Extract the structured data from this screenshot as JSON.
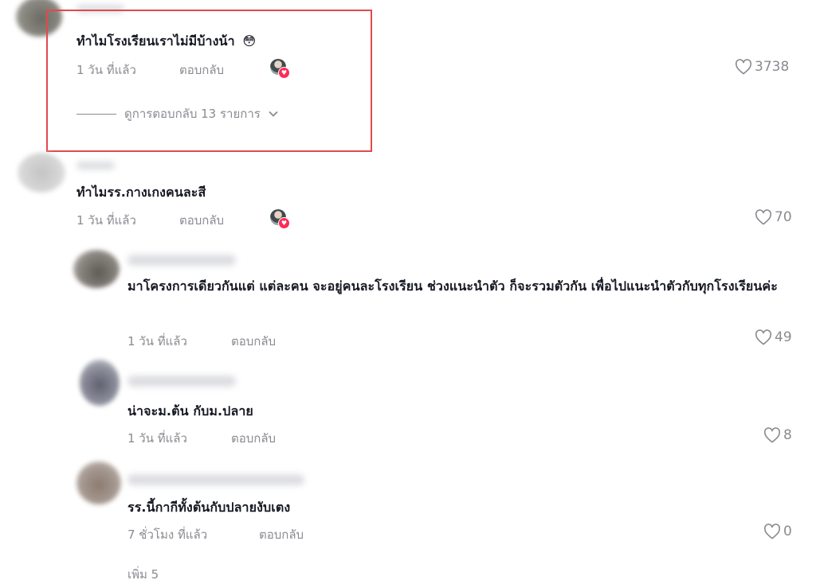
{
  "comments": [
    {
      "text": "ทำไมโรงเรียนเราไม่มีบ้างน้า",
      "emoji": "😳",
      "time": "1 วัน ที่แล้ว",
      "reply_label": "ตอบกลับ",
      "likes": "3738",
      "view_replies": "ดูการตอบกลับ 13 รายการ",
      "creator_liked": true
    },
    {
      "text": "ทำไมรร.กางเกงคนละสี",
      "time": "1 วัน ที่แล้ว",
      "reply_label": "ตอบกลับ",
      "likes": "70",
      "creator_liked": true
    },
    {
      "text": "มาโครงการเดียวกันแต่ แต่ละคน จะอยู่คนละโรงเรียน ช่วงแนะนำตัว ก็จะรวมตัวกัน เพื่อไปแนะนำตัวกับทุกโรงเรียนค่ะ",
      "time": "1 วัน ที่แล้ว",
      "reply_label": "ตอบกลับ",
      "likes": "49"
    },
    {
      "text": "น่าจะม.ต้น กับม.ปลาย",
      "time": "1 วัน ที่แล้ว",
      "reply_label": "ตอบกลับ",
      "likes": "8"
    },
    {
      "text": "รร.นี้กากีทั้งต้นกับปลายงับเตง",
      "time": "7 ชั่วโมง ที่แล้ว",
      "reply_label": "ตอบกลับ",
      "likes": "0"
    }
  ],
  "footer_partial": "เพิ่ม 5",
  "colors": {
    "highlight": "#e04a4d",
    "muted": "#8a8b91",
    "text": "#161823",
    "heart_badge": "#fe2c55"
  },
  "icons": {
    "like": "heart-outline-icon",
    "expand": "chevron-down-icon"
  }
}
